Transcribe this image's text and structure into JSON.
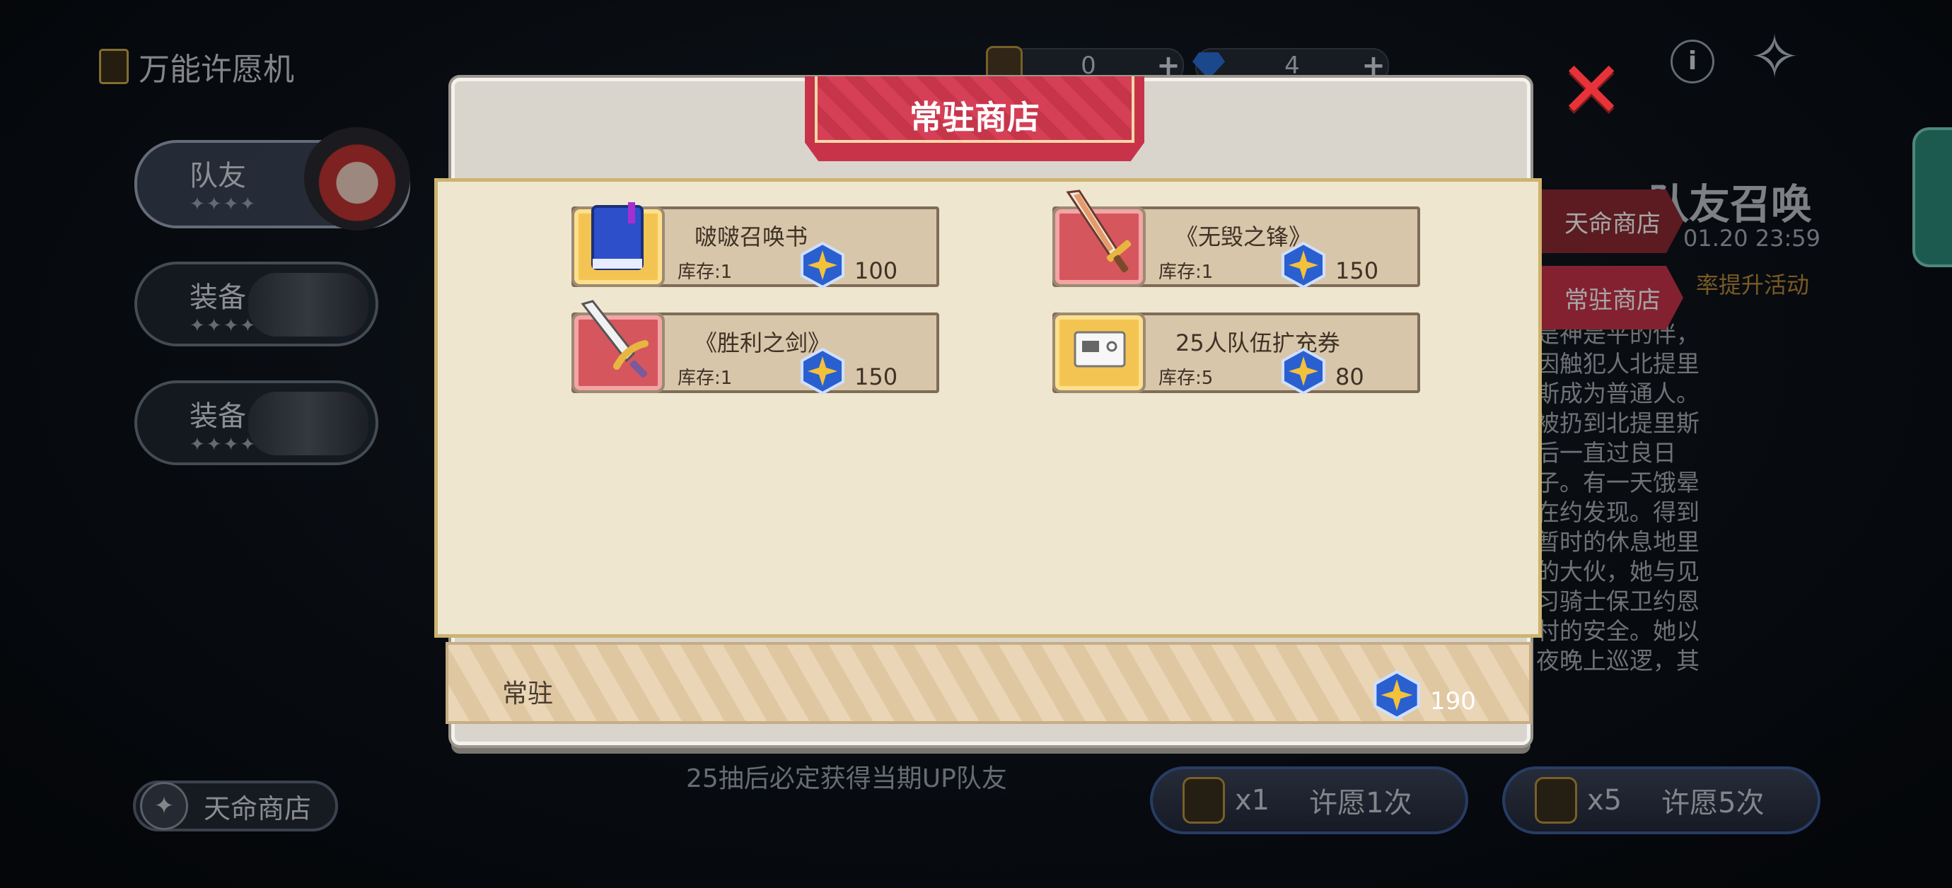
{
  "background": {
    "app_title": "万能许愿机",
    "sidebar": [
      {
        "label": "队友",
        "stars": "✦✦✦✦"
      },
      {
        "label": "装备",
        "stars": "✦✦✦✦"
      },
      {
        "label": "装备",
        "stars": "✦✦✦✦"
      }
    ],
    "currency": [
      {
        "icon": "summon-ticket-icon",
        "value": "0"
      },
      {
        "icon": "diamond-icon",
        "value": "4"
      }
    ],
    "right_tabs": [
      {
        "label": "天命商店",
        "color": "#8c2a34"
      },
      {
        "label": "常驻商店",
        "color": "#c9334a"
      }
    ],
    "banner_title": "队友召唤",
    "banner_date": "01.20 23:59",
    "banner_event": "率提升活动",
    "banner_desc": "是神是平的伴，因触犯人北提里斯成为普通人。被扔到北提里斯后一直过良日子。有一天饿晕在约发现。得到暂时的休息地里的大伙，她与见习骑士保卫约恩村的安全。她以夜晚上巡逻，其兜帽下藏己，夜晚会唤醒黑暗之力，妨在约恩村周遭的邪恶灵的帮助下她成为了灵魂收转化为战斗力量，重新与",
    "destiny_shop_button": "天命商店",
    "hint": "25抽后必定获得当期UP队友",
    "wish_buttons": [
      {
        "count": "x1",
        "label": "许愿1次"
      },
      {
        "count": "x5",
        "label": "许愿5次"
      }
    ]
  },
  "modal": {
    "title": "常驻商店",
    "items": [
      {
        "name": "啵啵召唤书",
        "stock": "库存:1",
        "price": "100",
        "thumb": "gold",
        "icon": "book-icon"
      },
      {
        "name": "《无毁之锋》",
        "stock": "库存:1",
        "price": "150",
        "thumb": "red",
        "icon": "sword-icon"
      },
      {
        "name": "《胜利之剑》",
        "stock": "库存:1",
        "price": "150",
        "thumb": "red",
        "icon": "sword-icon"
      },
      {
        "name": "25人队伍扩充券",
        "stock": "库存:5",
        "price": "80",
        "thumb": "gold",
        "icon": "ticket-icon"
      }
    ],
    "footer_label": "常驻",
    "footer_balance": "190"
  },
  "colors": {
    "accent_red": "#c9334a",
    "gem_blue": "#2a5fd0",
    "gem_gold": "#f3c13a",
    "panel_cream": "#efe6cf"
  }
}
